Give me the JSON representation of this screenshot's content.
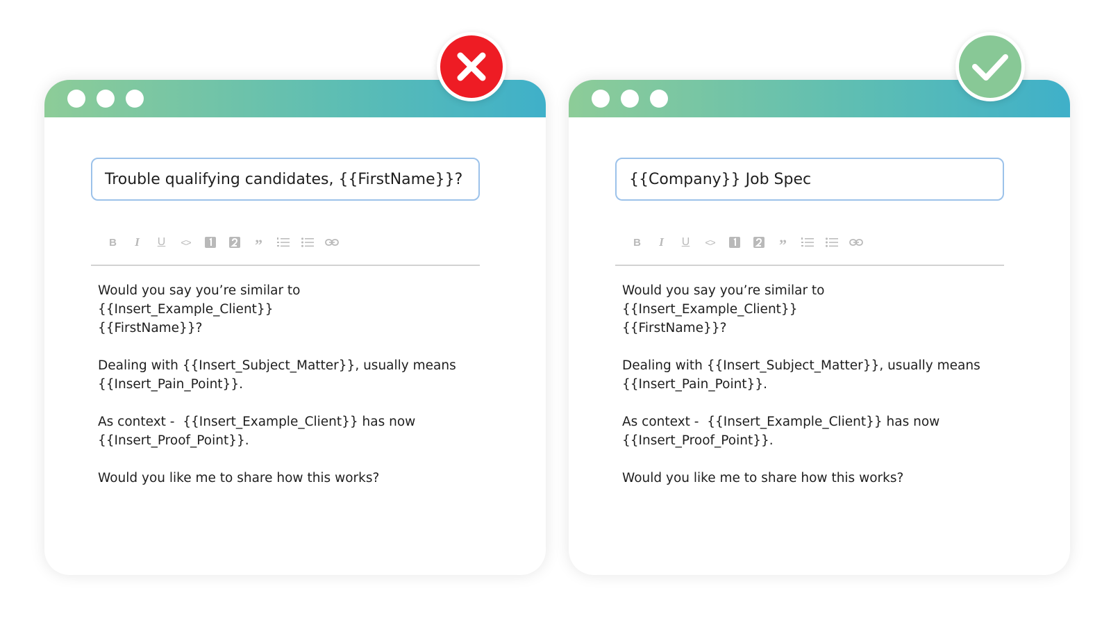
{
  "colors": {
    "titlebar_gradient": [
      "#8dcc98",
      "#5cbdb4",
      "#3fb0c9"
    ],
    "bad_badge": "#ee1c24",
    "good_badge": "#88c896",
    "input_border": "#9cc2ea",
    "toolbar_icon": "#b9b9b9"
  },
  "toolbar": {
    "icons": [
      "bold-icon",
      "italic-icon",
      "underline-icon",
      "code-icon",
      "heading-1-icon",
      "heading-2-icon",
      "quote-icon",
      "ordered-list-icon",
      "bullet-list-icon",
      "link-icon"
    ],
    "bold": "B",
    "italic": "I",
    "underline": "U",
    "code": "<>",
    "quote": "”"
  },
  "left_panel": {
    "status_icon": "x-mark-icon",
    "subject": "Trouble qualifying candidates, {{FirstName}}?",
    "body": [
      "Would you say you’re similar to {{Insert_Example_Client}}\n{{FirstName}}?",
      "Dealing with {{Insert_Subject_Matter}}, usually means\n{{Insert_Pain_Point}}.",
      "As context -  {{Insert_Example_Client}} has now\n{{Insert_Proof_Point}}.",
      "Would you like me to share how this works?"
    ]
  },
  "right_panel": {
    "status_icon": "checkmark-icon",
    "subject": "{{Company}} Job Spec",
    "body": [
      "Would you say you’re similar to {{Insert_Example_Client}}\n{{FirstName}}?",
      "Dealing with {{Insert_Subject_Matter}}, usually means\n{{Insert_Pain_Point}}.",
      "As context -  {{Insert_Example_Client}} has now\n{{Insert_Proof_Point}}.",
      "Would you like me to share how this works?"
    ]
  }
}
